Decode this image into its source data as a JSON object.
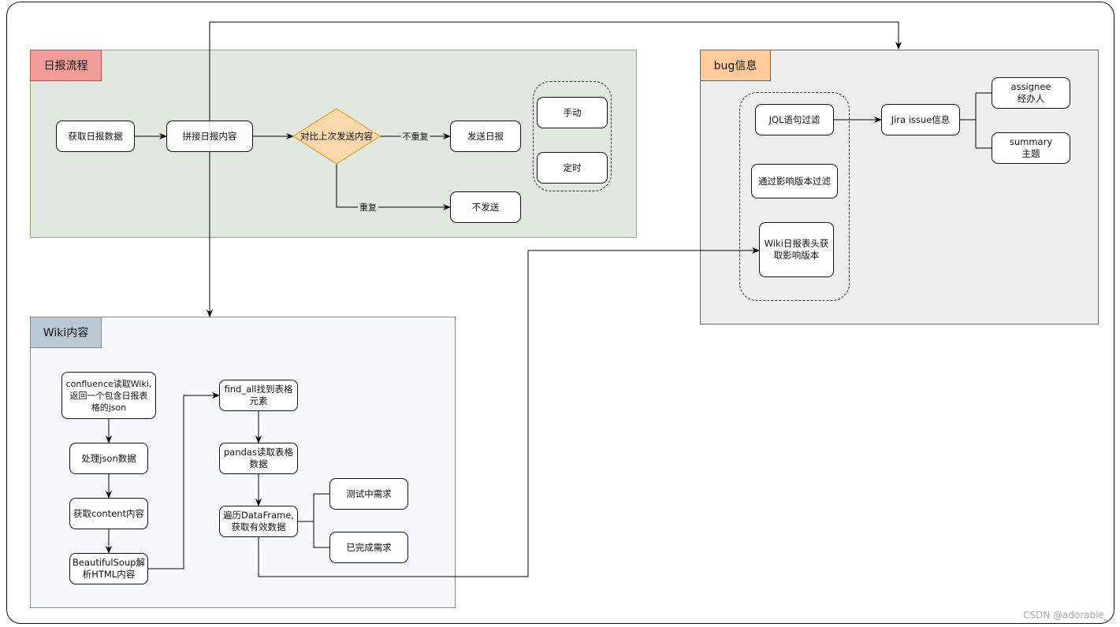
{
  "groups": {
    "daily": {
      "title": "日报流程",
      "fill": "#e0e8e0",
      "border": "#82b366",
      "title_fill": "#f19c99",
      "title_border": "#b85450"
    },
    "bug": {
      "title": "bug信息",
      "fill": "#eeeeee",
      "border": "#666666",
      "title_fill": "#ffcc99",
      "title_border": "#666666"
    },
    "wiki": {
      "title": "Wiki内容",
      "fill": "#f5f9fd",
      "border": "#888888",
      "title_fill": "#bac8d3",
      "title_border": "#888888"
    }
  },
  "daily_nodes": {
    "get_data": "获取日报数据",
    "assemble": "拼接日报内容",
    "compare": "对比上次发送内容",
    "send": "发送日报",
    "no_send": "不发送",
    "manual": "手动",
    "scheduled": "定时",
    "edge_not_dup": "不重复",
    "edge_dup": "重复"
  },
  "bug_nodes": {
    "jql": "JQL语句过滤",
    "version_filter": "通过影响版本过滤",
    "wiki_header": "Wiki日报表头获\n取影响版本",
    "jira_issue": "Jira issue信息",
    "assignee": "assignee\n经办人",
    "summary": "summary\n主题"
  },
  "wiki_nodes": {
    "confluence": "confluence读取Wiki,\n返回一个包含日报表\n格的json",
    "process_json": "处理json数据",
    "get_content": "获取content内容",
    "bs_parse": "BeautifulSoup解\n析HTML内容",
    "find_all": "find_all找到表格\n元素",
    "pandas": "pandas读取表格\n数据",
    "iterate": "遍历DataFrame,\n获取有效数据",
    "testing": "测试中需求",
    "done": "已完成需求"
  },
  "watermark": "CSDN @adorable_"
}
